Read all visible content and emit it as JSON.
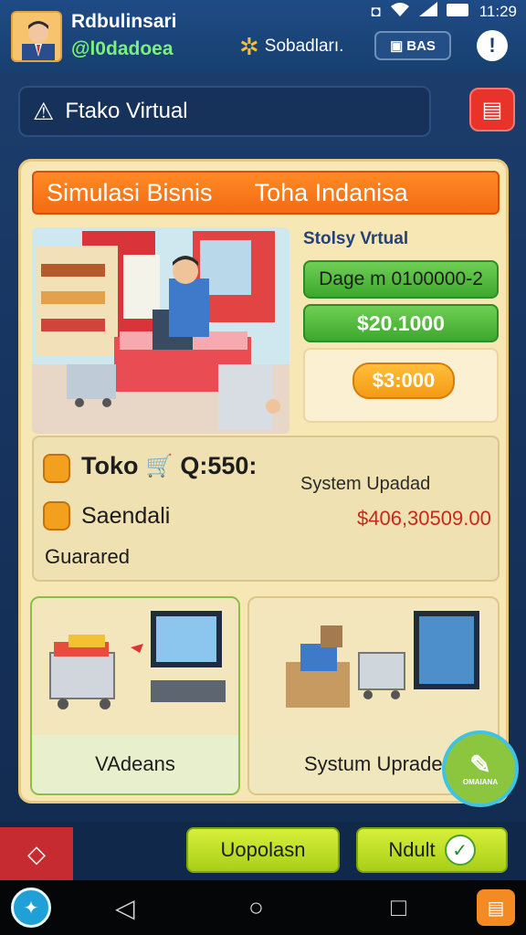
{
  "status": {
    "time": "11:29",
    "icons": [
      "notification-icon",
      "wifi-icon",
      "signal-icon",
      "battery-icon"
    ]
  },
  "header": {
    "username": "Rdbulinsari",
    "handle": "@l0dadoea",
    "gear_label": "Sobadları.",
    "bas_label": "BAS",
    "more_label": "!"
  },
  "alert": {
    "text": "Ftako Virtual"
  },
  "panel": {
    "title_left": "Simulasi Bisnis",
    "title_right": "Toha Indanisa",
    "store_label": "Stolsy Vrtual",
    "btn_dage": "Dage m 0100000-2",
    "btn_price_green": "$20.1000",
    "btn_price_orange": "$3:000"
  },
  "info": {
    "toko_label": "Toko",
    "toko_code": "Q:550:",
    "system_updated": "System Upadad",
    "saendali_label": "Saendali",
    "price_red": "$406,30509.00",
    "guarded": "Guarared"
  },
  "cards": {
    "left_label": "VAdeans",
    "right_label": "Systum Uprade"
  },
  "fab": {
    "label": "OMAIANA"
  },
  "footer": {
    "btn_left": "Uopolasn",
    "btn_right": "Ndult"
  },
  "colors": {
    "accent_orange": "#f36b12",
    "accent_green": "#3da72d",
    "accent_red": "#c8281e",
    "lime": "#a8cf18",
    "panel_bg": "#f6e7b5"
  }
}
